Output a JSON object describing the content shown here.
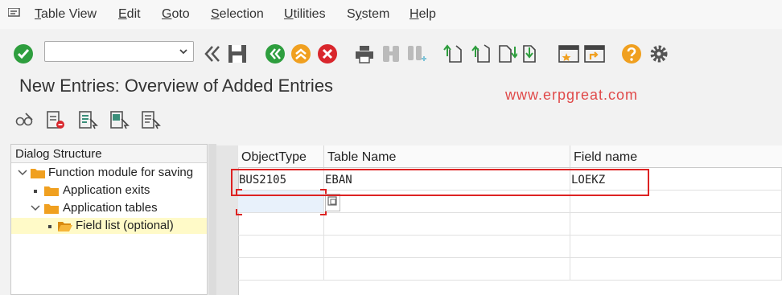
{
  "menubar": {
    "items": [
      {
        "label": "Table View",
        "accel": "T",
        "rest": "able View"
      },
      {
        "label": "Edit",
        "accel": "E",
        "rest": "dit"
      },
      {
        "label": "Goto",
        "accel": "G",
        "rest": "oto"
      },
      {
        "label": "Selection",
        "accel": "S",
        "rest": "election"
      },
      {
        "label": "Utilities",
        "accel": "U",
        "rest": "tilities"
      },
      {
        "label": "System",
        "accel": "y",
        "pre": "S",
        "rest": "stem"
      },
      {
        "label": "Help",
        "accel": "H",
        "rest": "elp"
      }
    ]
  },
  "toolbar": {
    "command_field": {
      "value": "",
      "placeholder": ""
    },
    "colors": {
      "green": "#2e9e3e",
      "orange": "#f0a020",
      "red": "#d9262c",
      "teal": "#3a8f7a",
      "gray": "#555555"
    }
  },
  "page": {
    "title": "New Entries: Overview of Added Entries",
    "watermark": "www.erpgreat.com"
  },
  "dialog_structure": {
    "title": "Dialog Structure",
    "nodes": [
      {
        "label": "Function module for saving",
        "expanded": true
      },
      {
        "label": "Application exits"
      },
      {
        "label": "Application tables",
        "expanded": true
      },
      {
        "label": "Field list (optional)",
        "selected": true
      }
    ]
  },
  "table": {
    "columns": [
      "ObjectType",
      "Table Name",
      "Field name"
    ],
    "rows": [
      [
        "BUS2105",
        "EBAN",
        "LOEKZ"
      ],
      [
        "",
        "",
        ""
      ],
      [
        "",
        "",
        ""
      ],
      [
        "",
        "",
        ""
      ],
      [
        "",
        "",
        ""
      ]
    ]
  }
}
